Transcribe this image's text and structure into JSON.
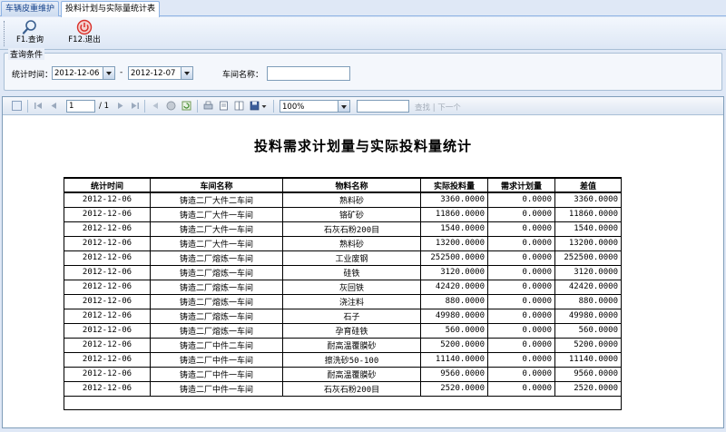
{
  "tabs": [
    {
      "label": "车辆皮重维护"
    },
    {
      "label": "投料计划与实际量统计表"
    }
  ],
  "toolbar": {
    "query_label": "F1.查询",
    "exit_label": "F12.退出"
  },
  "query": {
    "legend": "查询条件",
    "date_label": "统计时间：",
    "date_from": "2012-12-06",
    "date_sep": "-",
    "date_to": "2012-12-07",
    "workshop_label": "车间名称：",
    "workshop_value": ""
  },
  "viewer": {
    "page_value": "1",
    "page_total": "/ 1",
    "zoom": "100%",
    "find_value": "",
    "find_label": "查找 | 下一个"
  },
  "report": {
    "title": "投料需求计划量与实际投料量统计",
    "columns": [
      "统计时间",
      "车间名称",
      "物料名称",
      "实际投料量",
      "需求计划量",
      "差值"
    ],
    "rows": [
      [
        "2012-12-06",
        "铸造二厂大件二车间",
        "熟料砂",
        "3360.0000",
        "0.0000",
        "3360.0000"
      ],
      [
        "2012-12-06",
        "铸造二厂大件一车间",
        "铬矿砂",
        "11860.0000",
        "0.0000",
        "11860.0000"
      ],
      [
        "2012-12-06",
        "铸造二厂大件一车间",
        "石灰石粉200目",
        "1540.0000",
        "0.0000",
        "1540.0000"
      ],
      [
        "2012-12-06",
        "铸造二厂大件一车间",
        "熟料砂",
        "13200.0000",
        "0.0000",
        "13200.0000"
      ],
      [
        "2012-12-06",
        "铸造二厂熔炼一车间",
        "工业废钢",
        "252500.0000",
        "0.0000",
        "252500.0000"
      ],
      [
        "2012-12-06",
        "铸造二厂熔炼一车间",
        "硅铁",
        "3120.0000",
        "0.0000",
        "3120.0000"
      ],
      [
        "2012-12-06",
        "铸造二厂熔炼一车间",
        "灰回铁",
        "42420.0000",
        "0.0000",
        "42420.0000"
      ],
      [
        "2012-12-06",
        "铸造二厂熔炼一车间",
        "浇注料",
        "880.0000",
        "0.0000",
        "880.0000"
      ],
      [
        "2012-12-06",
        "铸造二厂熔炼一车间",
        "石子",
        "49980.0000",
        "0.0000",
        "49980.0000"
      ],
      [
        "2012-12-06",
        "铸造二厂熔炼一车间",
        "孕育硅铁",
        "560.0000",
        "0.0000",
        "560.0000"
      ],
      [
        "2012-12-06",
        "铸造二厂中件二车间",
        "耐高温覆膜砂",
        "5200.0000",
        "0.0000",
        "5200.0000"
      ],
      [
        "2012-12-06",
        "铸造二厂中件一车间",
        "擦洗砂50-100",
        "11140.0000",
        "0.0000",
        "11140.0000"
      ],
      [
        "2012-12-06",
        "铸造二厂中件一车间",
        "耐高温覆膜砂",
        "9560.0000",
        "0.0000",
        "9560.0000"
      ],
      [
        "2012-12-06",
        "铸造二厂中件一车间",
        "石灰石粉200目",
        "2520.0000",
        "0.0000",
        "2520.0000"
      ]
    ]
  },
  "colors": {
    "accent": "#15428b",
    "exit_red": "#d9302a",
    "tab_border": "#8db2e3"
  }
}
